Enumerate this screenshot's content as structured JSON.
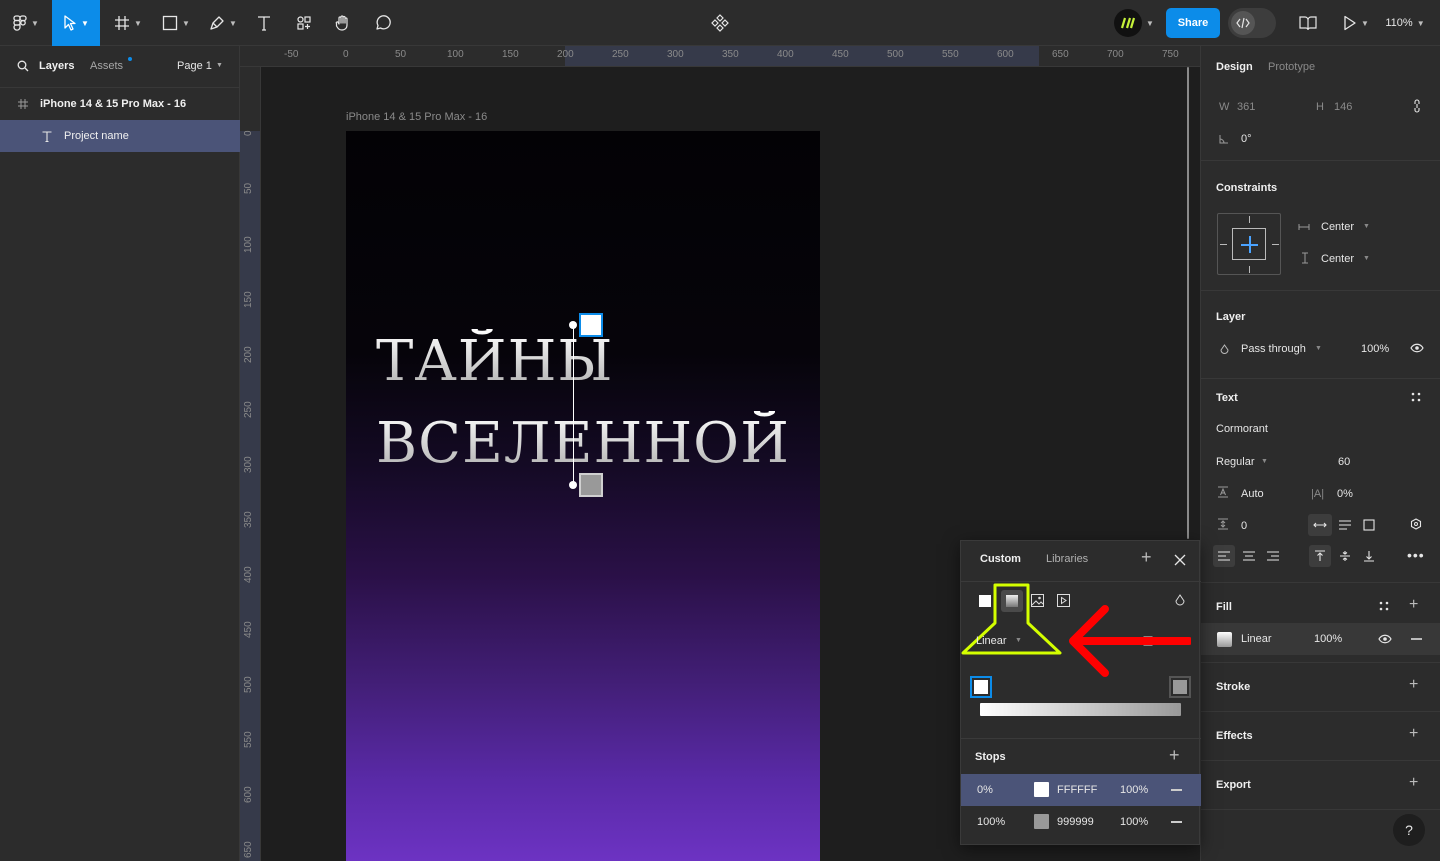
{
  "toolbar": {
    "share_label": "Share",
    "zoom_label": "110%"
  },
  "left_panel": {
    "tabs": [
      "Layers",
      "Assets"
    ],
    "page_label": "Page 1",
    "layers": [
      {
        "label": "iPhone 14 & 15 Pro Max - 16",
        "type": "frame"
      },
      {
        "label": "Project name",
        "type": "text"
      }
    ]
  },
  "rulers": {
    "top": [
      "-50",
      "0",
      "50",
      "100",
      "150",
      "200",
      "250",
      "300",
      "350",
      "400",
      "450",
      "500",
      "550",
      "600",
      "650",
      "700",
      "750"
    ],
    "left": [
      "0",
      "50",
      "100",
      "150",
      "200",
      "250",
      "300",
      "350",
      "400",
      "450",
      "500",
      "550",
      "600",
      "650"
    ]
  },
  "canvas": {
    "frame_label": "iPhone 14 & 15 Pro Max - 16",
    "heading_line1": "ТАЙНЫ",
    "heading_line2": "ВСЕЛЕННОЙ"
  },
  "design_panel": {
    "tabs": [
      "Design",
      "Prototype"
    ],
    "w_label": "W",
    "w_value": "361",
    "h_label": "H",
    "h_value": "146",
    "rotation": "0°",
    "constraints_title": "Constraints",
    "constraint_h": "Center",
    "constraint_v": "Center",
    "layer_title": "Layer",
    "blend_mode": "Pass through",
    "layer_opacity": "100%",
    "text_title": "Text",
    "font_family": "Cormorant",
    "font_weight": "Regular",
    "font_size": "60",
    "line_height": "Auto",
    "letter_spacing": "0%",
    "paragraph_spacing": "0",
    "fill_title": "Fill",
    "fill_type": "Linear",
    "fill_opacity": "100%",
    "stroke_title": "Stroke",
    "effects_title": "Effects",
    "export_title": "Export",
    "help": "?"
  },
  "color_picker": {
    "tabs": [
      "Custom",
      "Libraries"
    ],
    "gradient_type": "Linear",
    "stops_title": "Stops",
    "stops": [
      {
        "position": "0%",
        "hex": "FFFFFF",
        "opacity": "100%",
        "color": "#ffffff"
      },
      {
        "position": "100%",
        "hex": "999999",
        "opacity": "100%",
        "color": "#999999"
      }
    ]
  },
  "colors": {
    "accent": "#0c8ce9",
    "highlight": "#d4ff00",
    "arrow": "#ff0000"
  }
}
